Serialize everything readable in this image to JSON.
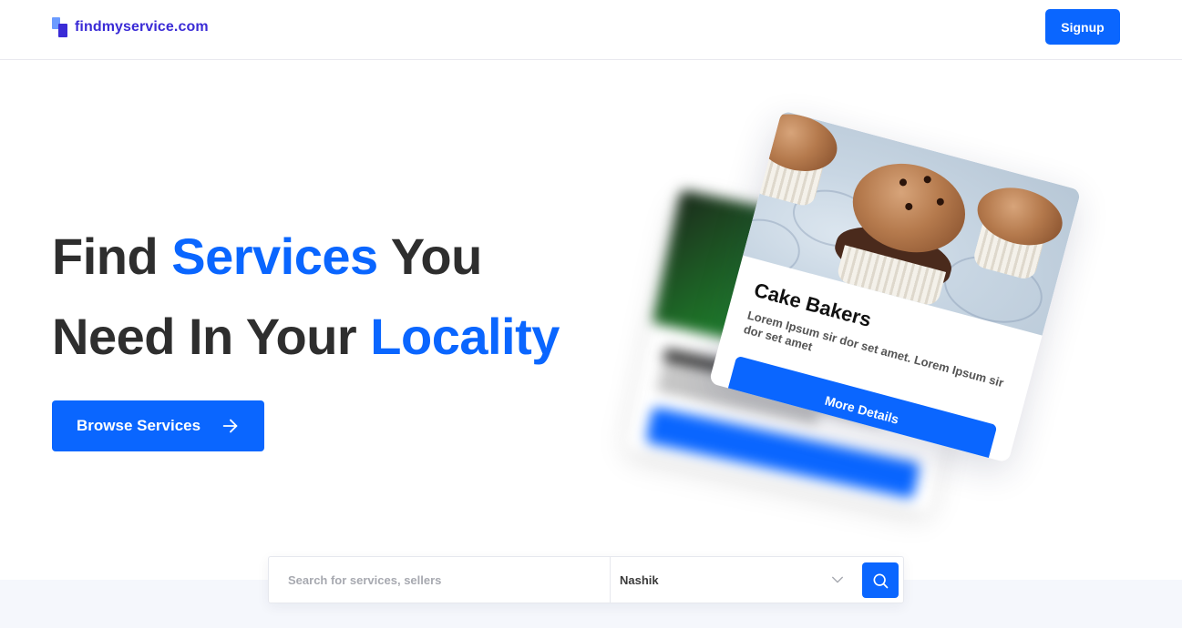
{
  "header": {
    "logo_text": "findmyservice.com",
    "signup_label": "Signup"
  },
  "hero": {
    "line1_part1": "Find ",
    "line1_accent": "Services",
    "line1_part2": " You",
    "line2_part1": "Need In Your ",
    "line2_accent": "Locality",
    "browse_label": "Browse Services"
  },
  "card": {
    "title": "Cake Bakers",
    "description": "Lorem Ipsum sir dor set amet. Lorem Ipsum sir dor set amet",
    "button_label": "More Details"
  },
  "search": {
    "placeholder": "Search for services, sellers",
    "location": "Nashik"
  },
  "colors": {
    "accent": "#0a66ff",
    "logo": "#3a2bd6",
    "text": "#2e2e2e"
  },
  "icons": [
    "logo-icon",
    "arrow-right-icon",
    "chevron-down-icon",
    "search-icon"
  ]
}
